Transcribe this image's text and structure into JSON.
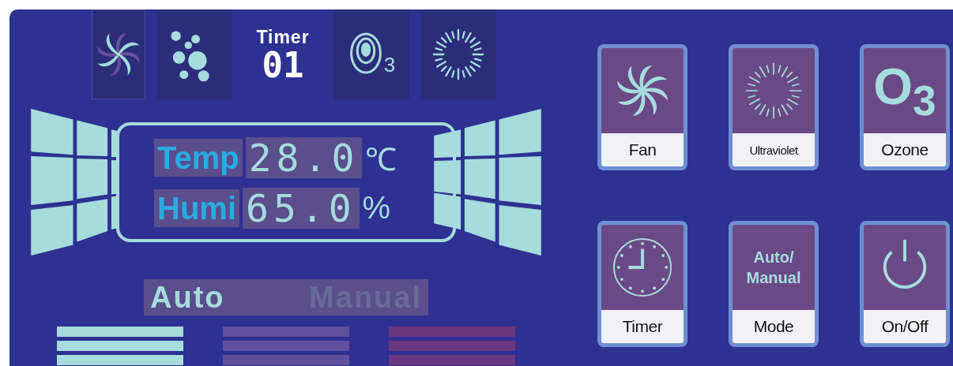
{
  "status_icons": [
    {
      "kind": "fan"
    },
    {
      "kind": "bubbles"
    },
    {
      "kind": "timer",
      "label": "Timer",
      "value": "01"
    },
    {
      "kind": "ozone",
      "label": "3"
    },
    {
      "kind": "uv"
    }
  ],
  "readings": [
    {
      "label": "Temp",
      "value": "28.0",
      "unit": "℃"
    },
    {
      "label": "Humi",
      "value": "65.0",
      "unit": "%"
    }
  ],
  "modes": [
    {
      "label": "Auto",
      "selected": true
    },
    {
      "label": "Manual",
      "selected": false
    }
  ],
  "level_bars": [
    {
      "color": "#a6dcdc"
    },
    {
      "color": "#5f4f9c"
    },
    {
      "color": "#6b3680"
    }
  ],
  "buttons": [
    {
      "label": "Fan",
      "kind": "fan"
    },
    {
      "label": "Ultraviolet",
      "kind": "uv"
    },
    {
      "label": "Ozone",
      "kind": "ozone",
      "symbol": "O$_{3}$"
    },
    {
      "label": "Timer",
      "kind": "clock"
    },
    {
      "label": "Mode",
      "kind": "text",
      "caption": "Auto/ Manual"
    },
    {
      "label": "On/Off",
      "kind": "power"
    }
  ]
}
